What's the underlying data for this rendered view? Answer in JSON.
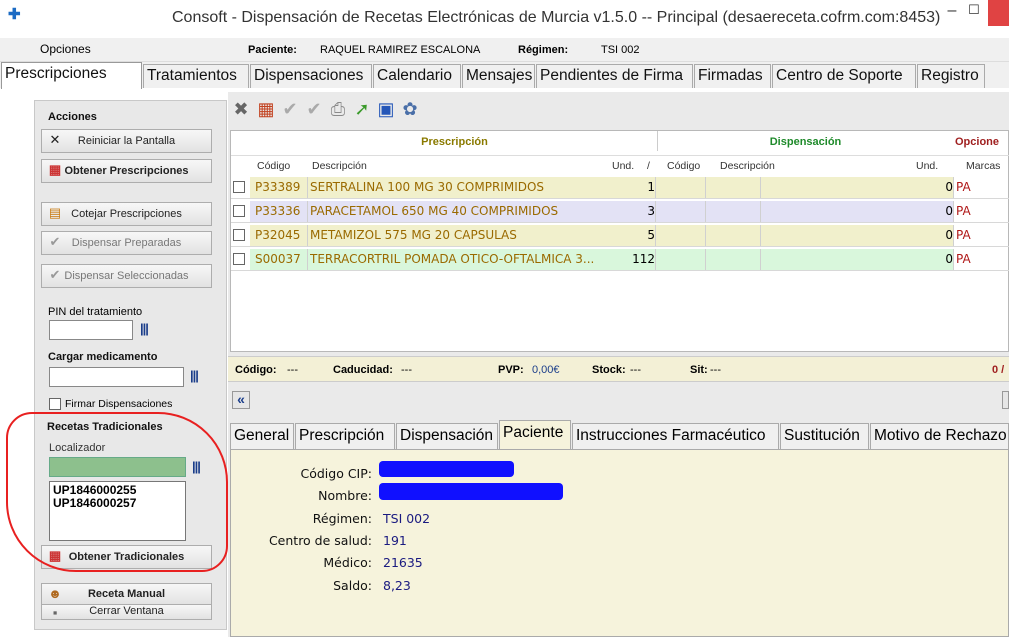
{
  "window": {
    "title": "Consoft - Dispensación de Recetas Electrónicas de Murcia v1.5.0  -- Principal (desaereceta.cofrm.com:8453)"
  },
  "menu": {
    "opciones": "Opciones"
  },
  "header": {
    "paciente_label": "Paciente:",
    "paciente_value": "RAQUEL RAMIREZ ESCALONA",
    "regimen_label": "Régimen:",
    "regimen_value": "TSI 002"
  },
  "tabs": [
    "Prescripciones",
    "Tratamientos",
    "Dispensaciones",
    "Calendario",
    "Mensajes",
    "Pendientes de Firma",
    "Firmadas",
    "Centro de Soporte",
    "Registro"
  ],
  "sidebar": {
    "acciones": "Acciones",
    "reiniciar": "Reiniciar la Pantalla",
    "obtener_prescripciones": "Obtener Prescripciones",
    "cotejar": "Cotejar Prescripciones",
    "dispensar_preparadas": "Dispensar Preparadas",
    "dispensar_seleccionadas": "Dispensar Seleccionadas",
    "pin_label": "PIN del tratamiento",
    "cargar_label": "Cargar medicamento",
    "firmar_label": "Firmar Dispensaciones",
    "recetas_tradicionales": "Recetas Tradicionales",
    "localizador_label": "Localizador",
    "localizadores": [
      "UP1846000255",
      "UP1846000257"
    ],
    "obtener_tradicionales": "Obtener Tradicionales",
    "receta_manual": "Receta Manual",
    "cerrar_ventana": "Cerrar Ventana"
  },
  "grid": {
    "group_prescripcion": "Prescripción",
    "group_dispensacion": "Dispensación",
    "group_opciones": "Opcione",
    "col_codigo": "Código",
    "col_descripcion": "Descripción",
    "col_und": "Und.",
    "col_sort": "/",
    "col_codigo2": "Código",
    "col_descripcion2": "Descripción",
    "col_und2": "Und.",
    "col_marcas": "Marcas",
    "rows": [
      {
        "codigo": "P33389",
        "descripcion": "SERTRALINA 100 MG 30 COMPRIMIDOS",
        "und": "1",
        "und2": "0",
        "marcas": "PA",
        "color": "#f1f0cc"
      },
      {
        "codigo": "P33336",
        "descripcion": "PARACETAMOL 650 MG 40 COMPRIMIDOS",
        "und": "3",
        "und2": "0",
        "marcas": "PA",
        "color": "#e3e2f5"
      },
      {
        "codigo": "P32045",
        "descripcion": "METAMIZOL 575 MG 20 CAPSULAS",
        "und": "5",
        "und2": "0",
        "marcas": "PA",
        "color": "#f1f0cc"
      },
      {
        "codigo": "S00037",
        "descripcion": "TERRACORTRIL POMADA OTICO-OFTALMICA 3...",
        "und": "112",
        "und2": "0",
        "marcas": "PA",
        "color": "#d9f7dc"
      }
    ]
  },
  "infobar": {
    "codigo": "Código:",
    "codigo_v": "---",
    "caducidad": "Caducidad:",
    "caducidad_v": "---",
    "pvp": "PVP:",
    "pvp_v": "0,00€",
    "stock": "Stock:",
    "stock_v": "---",
    "sit": "Sit:",
    "sit_v": "---",
    "count": "0 /"
  },
  "lower_tabs": [
    "General",
    "Prescripción",
    "Dispensación",
    "Paciente",
    "Instrucciones Farmacéutico",
    "Sustitución",
    "Motivo de Rechazo"
  ],
  "patient": {
    "cip_label": "Código CIP:",
    "nombre_label": "Nombre:",
    "regimen_label": "Régimen:",
    "regimen_value": "TSI 002",
    "centro_label": "Centro de salud:",
    "centro_value": "191",
    "medico_label": "Médico:",
    "medico_value": "21635",
    "saldo_label": "Saldo:",
    "saldo_value": "8,23"
  }
}
